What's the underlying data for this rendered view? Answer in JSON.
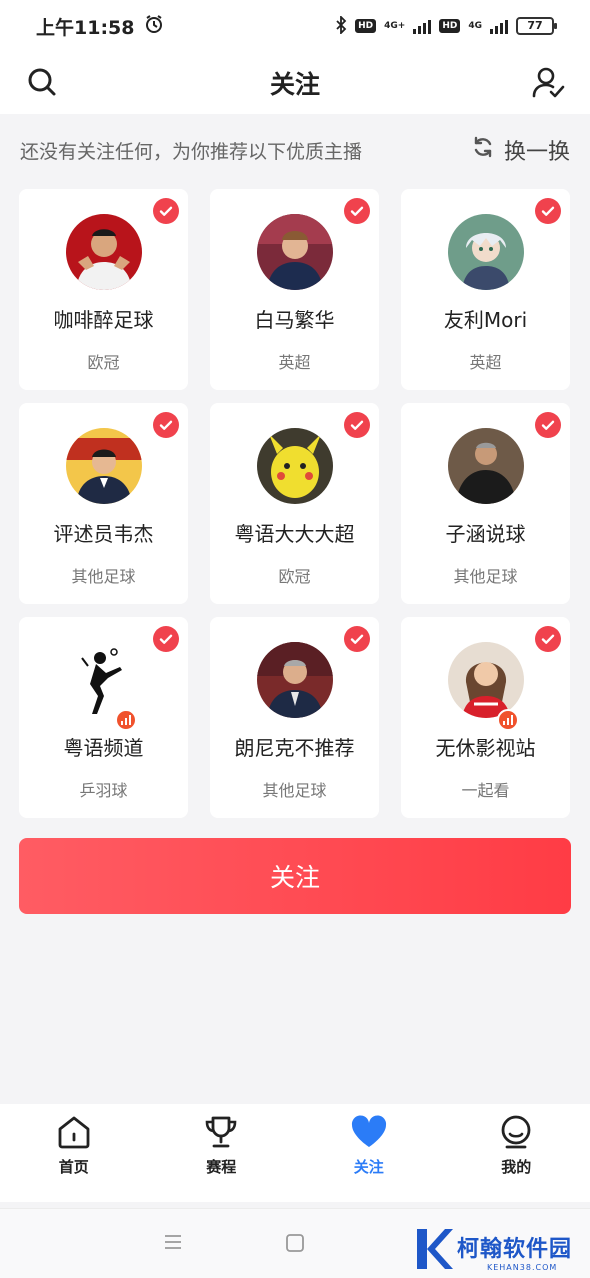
{
  "status_bar": {
    "time": "上午11:58",
    "network1": "4G+",
    "network2": "4G",
    "hd": "HD",
    "battery": "77"
  },
  "header": {
    "title": "关注"
  },
  "recommend": {
    "text": "还没有关注任何，为你推荐以下优质主播",
    "refresh_label": "换一换"
  },
  "cards": [
    {
      "name": "咖啡醉足球",
      "tag": "欧冠",
      "checked": true,
      "live": false
    },
    {
      "name": "白马繁华",
      "tag": "英超",
      "checked": true,
      "live": false
    },
    {
      "name": "友利Mori",
      "tag": "英超",
      "checked": true,
      "live": false
    },
    {
      "name": "评述员韦杰",
      "tag": "其他足球",
      "checked": true,
      "live": false
    },
    {
      "name": "粤语大大大超",
      "tag": "欧冠",
      "checked": true,
      "live": false
    },
    {
      "name": "子涵说球",
      "tag": "其他足球",
      "checked": true,
      "live": false
    },
    {
      "name": "粤语频道",
      "tag": "乒羽球",
      "checked": true,
      "live": true
    },
    {
      "name": "朗尼克不推荐",
      "tag": "其他足球",
      "checked": true,
      "live": false
    },
    {
      "name": "无休影视站",
      "tag": "一起看",
      "checked": true,
      "live": true
    }
  ],
  "follow_button": {
    "label": "关注"
  },
  "bottom_nav": [
    {
      "label": "首页",
      "icon": "home-icon",
      "active": false
    },
    {
      "label": "赛程",
      "icon": "trophy-icon",
      "active": false
    },
    {
      "label": "关注",
      "icon": "heart-icon",
      "active": true
    },
    {
      "label": "我的",
      "icon": "profile-icon",
      "active": false
    }
  ],
  "watermark": {
    "title": "柯翰软件园",
    "subtitle": "KEHAN38.COM"
  },
  "colors": {
    "accent_red": "#f0424d",
    "active_blue": "#2b7cf7",
    "background": "#f4f4f6"
  }
}
